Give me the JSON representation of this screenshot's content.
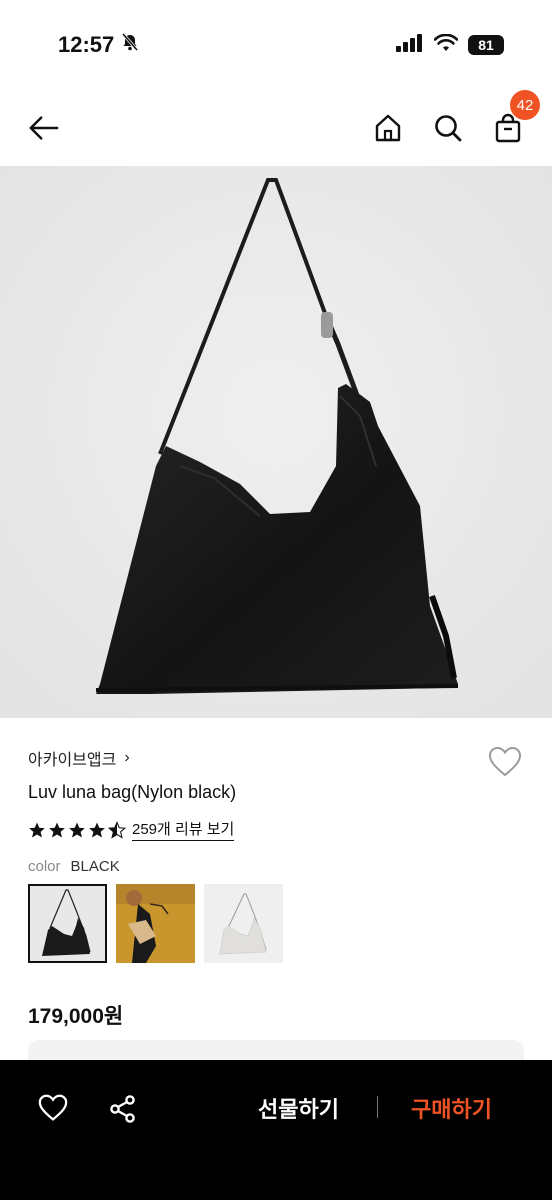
{
  "status_bar": {
    "time": "12:57",
    "battery": "81"
  },
  "nav": {
    "cart_count": "42"
  },
  "product": {
    "brand": "아카이브앱크",
    "brand_chevron": "›",
    "name": "Luv luna bag(Nylon black)",
    "rating": 4.5,
    "review_link": "259개 리뷰 보기",
    "color_label": "color",
    "color_value": "BLACK",
    "price": "179,000원"
  },
  "bottom_bar": {
    "gift_label": "선물하기",
    "buy_label": "구매하기"
  },
  "colors": {
    "accent": "#f05323",
    "bottom_bar_bg": "#000000"
  }
}
